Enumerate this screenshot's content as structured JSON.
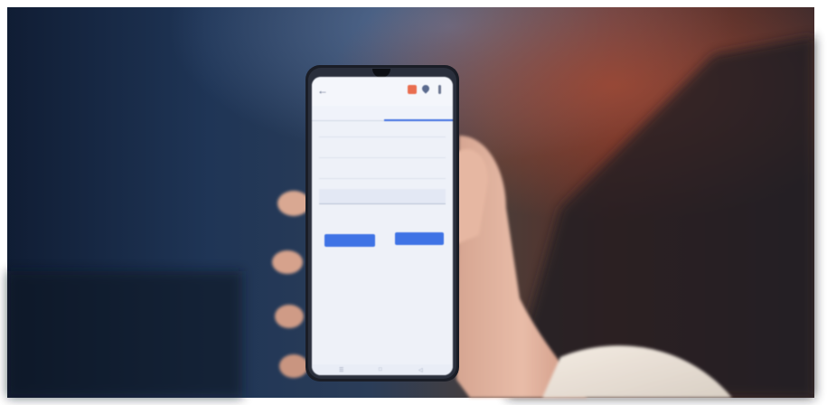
{
  "scene": {
    "description_icon": "hand-holding-phone-icon"
  },
  "phone": {
    "appbar": {
      "back_icon": "arrow-left-icon",
      "title": "",
      "icons": [
        "calendar-icon",
        "location-pin-icon",
        "more-vertical-icon"
      ]
    },
    "tabs": [
      {
        "label": ""
      },
      {
        "label": "",
        "active": true
      }
    ],
    "rows": [
      {
        "label": "",
        "value": ""
      },
      {
        "label": "",
        "value": ""
      },
      {
        "label": "",
        "value": ""
      }
    ],
    "fields": [
      {
        "label": "",
        "value": ""
      },
      {
        "label": "",
        "value": ""
      }
    ],
    "buttons": [
      {
        "label": ""
      },
      {
        "label": ""
      }
    ],
    "navbar_icons": [
      "menu-icon",
      "home-icon",
      "back-icon"
    ]
  }
}
